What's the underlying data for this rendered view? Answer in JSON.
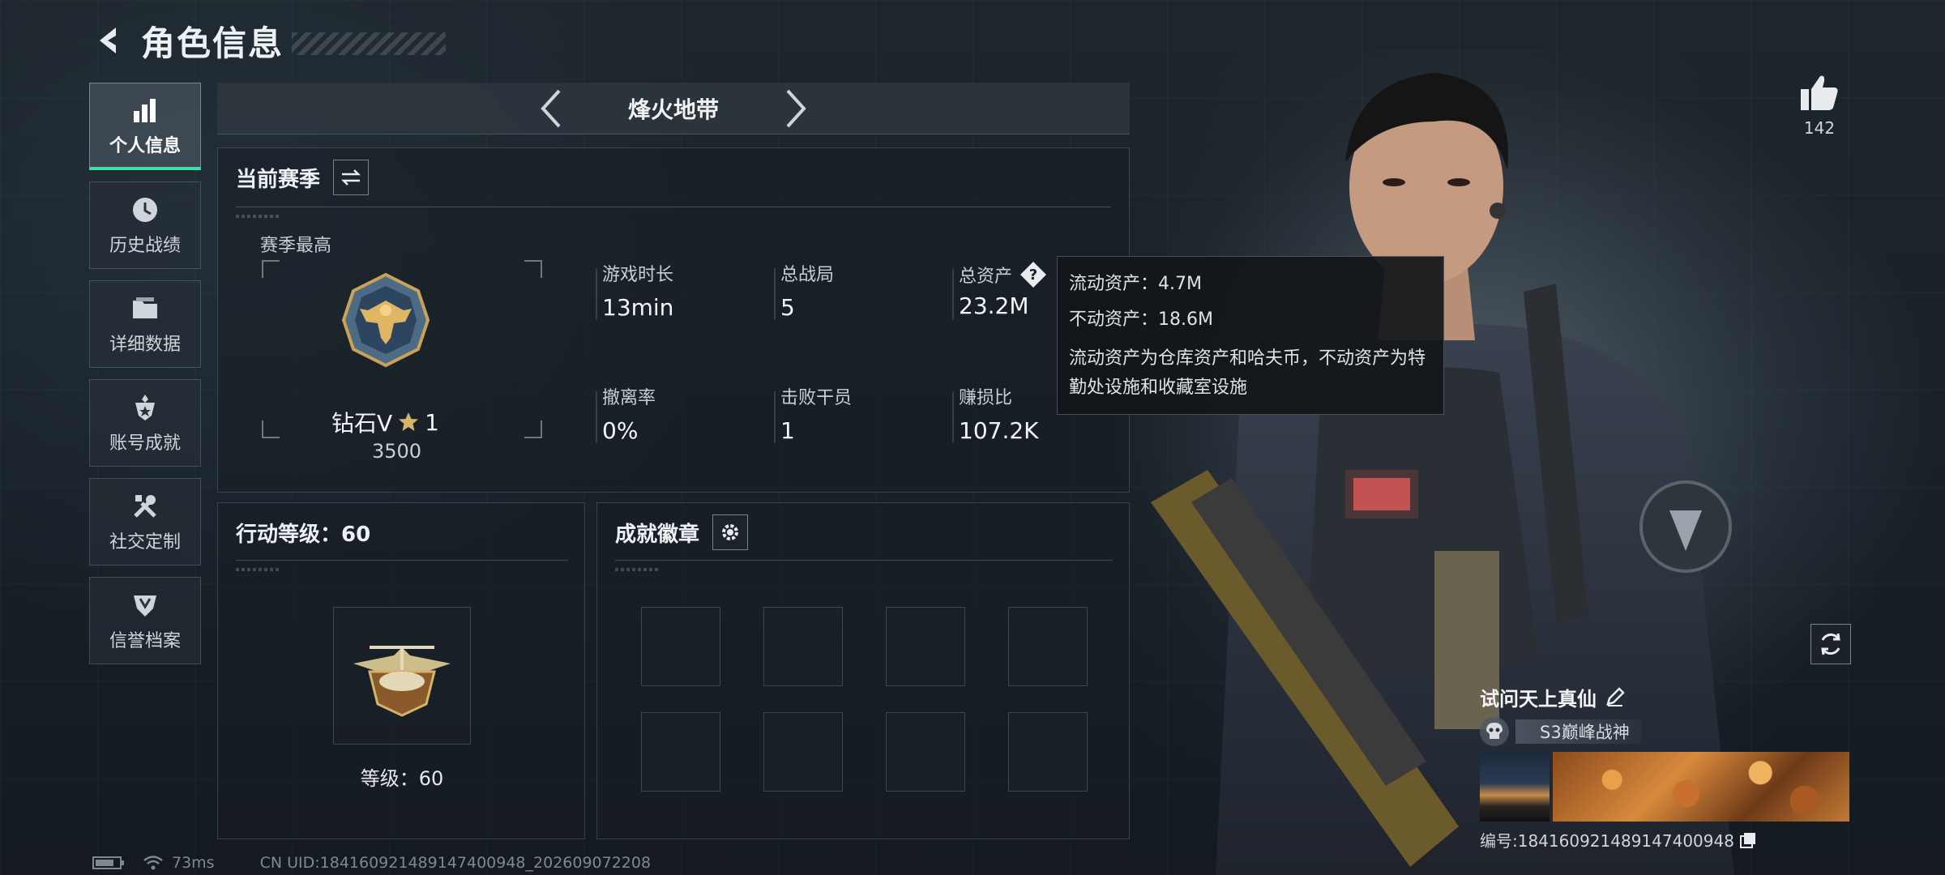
{
  "header": {
    "title": "角色信息"
  },
  "nav": [
    {
      "label": "个人信息",
      "icon": "bar-chart-icon",
      "active": true
    },
    {
      "label": "历史战绩",
      "icon": "clock-icon",
      "active": false
    },
    {
      "label": "详细数据",
      "icon": "folder-icon",
      "active": false
    },
    {
      "label": "账号成就",
      "icon": "medal-icon",
      "active": false
    },
    {
      "label": "社交定制",
      "icon": "tools-icon",
      "active": false
    },
    {
      "label": "信誉档案",
      "icon": "shield-icon",
      "active": false
    }
  ],
  "mode": {
    "name": "烽火地带"
  },
  "season": {
    "title": "当前赛季",
    "best_label": "赛季最高",
    "rank": "钻石V",
    "stars": "1",
    "score": "3500",
    "stats": [
      {
        "label": "游戏时长",
        "value": "13min"
      },
      {
        "label": "总战局",
        "value": "5"
      },
      {
        "label": "总资产",
        "value": "23.2M"
      },
      {
        "label": "撤离率",
        "value": "0%"
      },
      {
        "label": "击败干员",
        "value": "1"
      },
      {
        "label": "赚损比",
        "value": "107.2K"
      }
    ]
  },
  "tooltip": {
    "liquid": "流动资产：4.7M",
    "fixed": "不动资产：18.6M",
    "note": "流动资产为仓库资产和哈夫币，不动资产为特勤处设施和收藏室设施"
  },
  "level": {
    "title": "行动等级：60",
    "label": "等级：60"
  },
  "achievements": {
    "title": "成就徽章",
    "slots": 8
  },
  "likes": {
    "count": "142"
  },
  "player": {
    "name": "试问天上真仙",
    "title": "S3巅峰战神",
    "id": "编号:184160921489147400948"
  },
  "footer": {
    "ping": "73ms",
    "uid": "CN UID:184160921489147400948_202609072208"
  },
  "colors": {
    "accent": "#3ee0a8",
    "panel": "#181e24",
    "text": "#e6e9ec"
  }
}
